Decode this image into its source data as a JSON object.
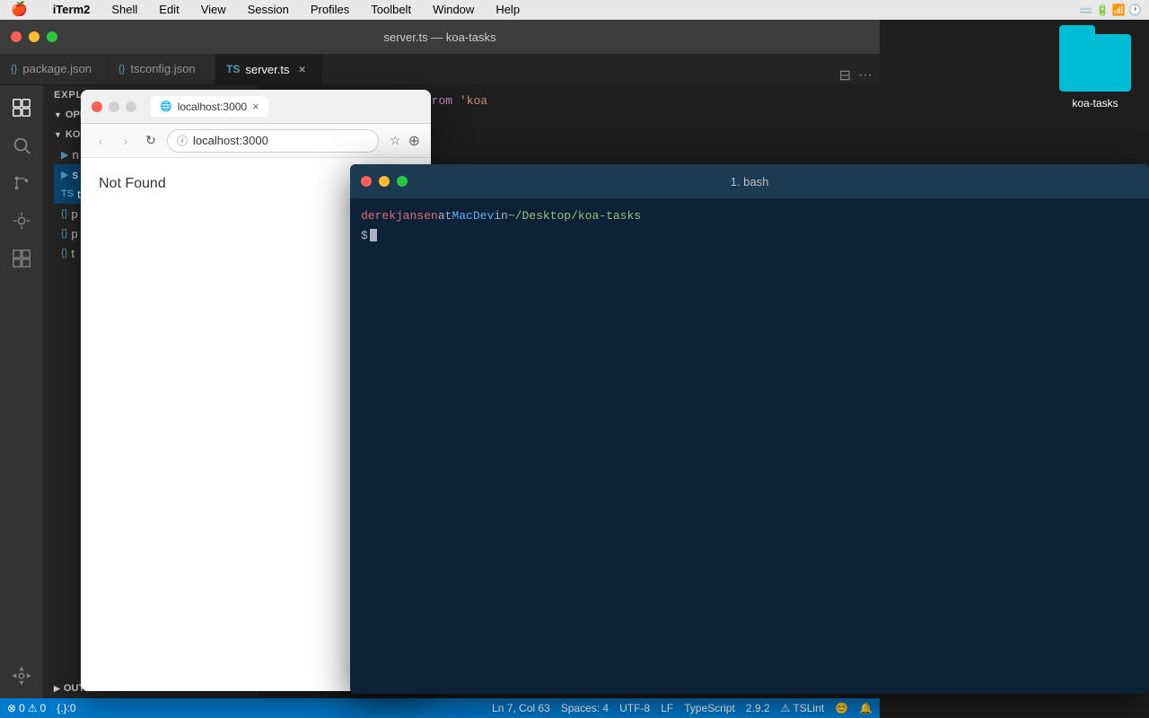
{
  "menubar": {
    "apple": "🍎",
    "items": [
      "iTerm2",
      "Shell",
      "Edit",
      "View",
      "Session",
      "Profiles",
      "Toolbelt",
      "Window",
      "Help"
    ],
    "bold_item": "iTerm2",
    "right": {
      "icons": [
        "battery",
        "wifi",
        "clock"
      ]
    }
  },
  "vscode": {
    "title": "server.ts — koa-tasks",
    "tabs": [
      {
        "id": "package",
        "icon": "{}",
        "label": "package.json",
        "active": false
      },
      {
        "id": "tsconfig",
        "icon": "{}",
        "label": "tsconfig.json",
        "active": false
      },
      {
        "id": "server",
        "icon": "TS",
        "label": "server.ts",
        "active": true,
        "closeable": true
      }
    ],
    "sidebar": {
      "title": "EXPLORER",
      "sections": [
        {
          "label": "OPEN EDITORS",
          "expanded": true
        },
        {
          "label": "KOA-TASKS",
          "expanded": true
        }
      ],
      "files": [
        "p",
        "p",
        "t"
      ],
      "outline": "OUTLINE"
    },
    "code": {
      "line1": "import * as Koa from 'koa'"
    },
    "statusbar": {
      "errors": "0",
      "warnings": "0",
      "json": "{.}:0",
      "position": "Ln 7, Col 63",
      "spaces": "Spaces: 4",
      "encoding": "UTF-8",
      "eol": "LF",
      "language": "TypeScript",
      "version": "2.9.2",
      "tslint": "⚠ TSLint",
      "emoji": "😊",
      "bell": "🔔"
    }
  },
  "koa_folder": {
    "label": "koa-tasks"
  },
  "browser": {
    "tab_label": "localhost:3000",
    "url": "localhost:3000",
    "not_found": "Not Found"
  },
  "terminal": {
    "title": "1. bash",
    "user": "derekjansen",
    "at": " at ",
    "host": "MacDev",
    "in": " in ",
    "path": "~/Desktop/koa-tasks",
    "dollar": "$"
  }
}
